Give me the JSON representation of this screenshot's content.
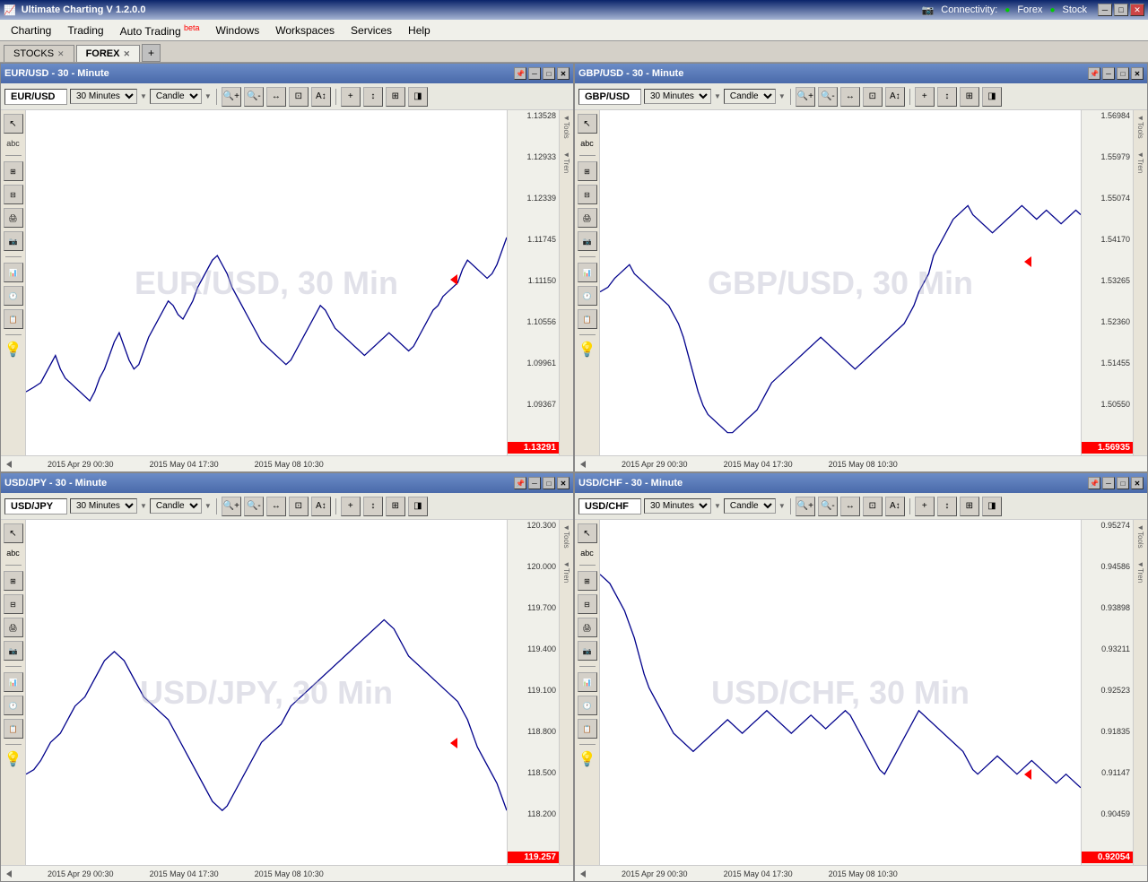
{
  "app": {
    "title": "Ultimate Charting V 1.2.0.0",
    "icon": "chart-icon"
  },
  "titlebar": {
    "minimize": "─",
    "maximize": "□",
    "close": "✕",
    "connectivity": "Connectivity:",
    "forex": "Forex",
    "stock": "Stock"
  },
  "menu": {
    "items": [
      {
        "label": "Charting",
        "beta": false
      },
      {
        "label": "Trading",
        "beta": false
      },
      {
        "label": "Auto Trading",
        "beta": true
      },
      {
        "label": "Windows",
        "beta": false
      },
      {
        "label": "Workspaces",
        "beta": false
      },
      {
        "label": "Services",
        "beta": false
      },
      {
        "label": "Help",
        "beta": false
      }
    ]
  },
  "tabs": [
    {
      "label": "STOCKS",
      "active": false
    },
    {
      "label": "FOREX",
      "active": true
    }
  ],
  "charts": [
    {
      "id": "eurusd",
      "title": "EUR/USD - 30 - Minute",
      "symbol": "EUR/USD",
      "timeframe": "30 Minutes",
      "chartType": "Candle",
      "currentPrice": "1.13291",
      "watermark": "EUR/USD, 30 Min",
      "xLabels": [
        "2015 Apr 29 00:30",
        "2015 May 04 17:30",
        "2015 May 08 10:30"
      ],
      "yScale": [
        "1.13528",
        "1.12933",
        "1.12339",
        "1.11745",
        "1.11150",
        "1.10556",
        "1.09961",
        "1.09367"
      ],
      "priceArrowTop": 188
    },
    {
      "id": "gbpusd",
      "title": "GBP/USD - 30 - Minute",
      "symbol": "GBP/USD",
      "timeframe": "30 Minutes",
      "chartType": "Candle",
      "currentPrice": "1.56935",
      "watermark": "GBP/USD, 30 Min",
      "xLabels": [
        "2015 Apr 29 00:30",
        "2015 May 04 17:30",
        "2015 May 08 10:30"
      ],
      "yScale": [
        "1.56984",
        "1.55979",
        "1.55074",
        "1.54170",
        "1.53265",
        "1.52360",
        "1.51455",
        "1.50550"
      ],
      "priceArrowTop": 170
    },
    {
      "id": "usdjpy",
      "title": "USD/JPY - 30 - Minute",
      "symbol": "USD/JPY",
      "timeframe": "30 Minutes",
      "chartType": "Candle",
      "currentPrice": "119.257",
      "watermark": "USD/JPY, 30 Min",
      "xLabels": [
        "2015 Apr 29 00:30",
        "2015 May 04 17:30",
        "2015 May 08 10:30"
      ],
      "yScale": [
        "120.300",
        "120.000",
        "119.700",
        "119.400",
        "119.100",
        "118.800",
        "118.500",
        "118.200"
      ],
      "priceArrowTop": 248
    },
    {
      "id": "usdchf",
      "title": "USD/CHF - 30 - Minute",
      "symbol": "USD/CHF",
      "timeframe": "30 Minutes",
      "chartType": "Candle",
      "currentPrice": "0.92054",
      "watermark": "USD/CHF, 30 Min",
      "xLabels": [
        "2015 Apr 29 00:30",
        "2015 May 04 17:30",
        "2015 May 08 10:30"
      ],
      "yScale": [
        "0.95274",
        "0.94586",
        "0.93898",
        "0.93211",
        "0.92523",
        "0.91835",
        "0.91147",
        "0.90459"
      ],
      "priceArrowTop": 282
    }
  ],
  "leftTools": [
    "↖",
    "abc",
    "···",
    "⊞",
    "⊟",
    "🖨",
    "📷",
    "📊",
    "🕐",
    "📋"
  ],
  "rightTools": [
    "◄Tools",
    "◄Tren"
  ],
  "toolbar_buttons": [
    "🔍+",
    "🔍-",
    "↔",
    "🔍",
    "A↕",
    "+",
    "↕",
    "⊞",
    "◨"
  ]
}
